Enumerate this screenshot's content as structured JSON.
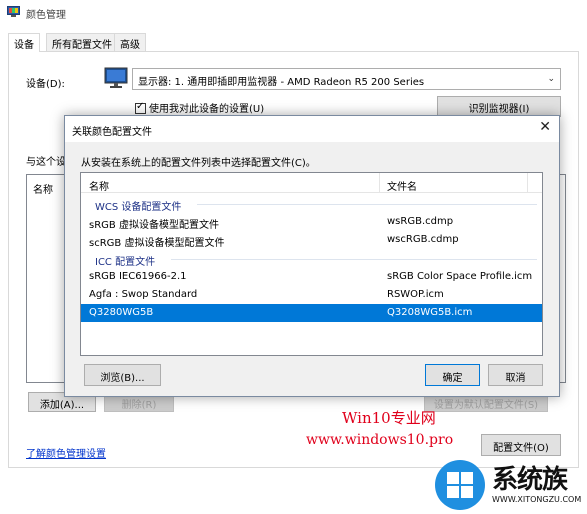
{
  "window": {
    "title": "颜色管理"
  },
  "tabs": [
    {
      "label": "设备",
      "active": true
    },
    {
      "label": "所有配置文件",
      "active": false
    },
    {
      "label": "高级",
      "active": false
    }
  ],
  "device": {
    "label": "设备(D):",
    "selected": "显示器: 1. 通用即插即用监视器 - AMD Radeon R5 200 Series",
    "use_my_settings": "使用我对此设备的设置(U)",
    "use_my_settings_checked": true,
    "identify_button": "识别监视器(I)"
  },
  "profiles": {
    "label": "与这个设",
    "column_name": "名称",
    "add_button": "添加(A)...",
    "remove_button": "删除(R)",
    "set_default_button": "设置为默认配置文件(S)"
  },
  "footer": {
    "learn_link": "了解颜色管理设置",
    "profiles_button": "配置文件(O)"
  },
  "dialog": {
    "title": "关联颜色配置文件",
    "instruction": "从安装在系统上的配置文件列表中选择配置文件(C)。",
    "columns": {
      "name": "名称",
      "file": "文件名"
    },
    "groups": [
      {
        "label": "WCS 设备配置文件",
        "items": [
          {
            "name": "sRGB 虚拟设备模型配置文件",
            "file": "wsRGB.cdmp",
            "selected": false
          },
          {
            "name": "scRGB 虚拟设备模型配置文件",
            "file": "wscRGB.cdmp",
            "selected": false
          }
        ]
      },
      {
        "label": "ICC 配置文件",
        "items": [
          {
            "name": "sRGB IEC61966-2.1",
            "file": "sRGB Color Space Profile.icm",
            "selected": false
          },
          {
            "name": "Agfa : Swop Standard",
            "file": "RSWOP.icm",
            "selected": false
          },
          {
            "name": "Q3280WG5B",
            "file": "Q3208WG5B.icm",
            "selected": true
          }
        ]
      }
    ],
    "browse_button": "浏览(B)...",
    "ok_button": "确定",
    "cancel_button": "取消"
  },
  "watermark": {
    "line1": "Win10专业网",
    "line2": "www.windows10.pro",
    "logo_text": "系统族",
    "logo_url": "WWW.XITONGZU.COM"
  }
}
